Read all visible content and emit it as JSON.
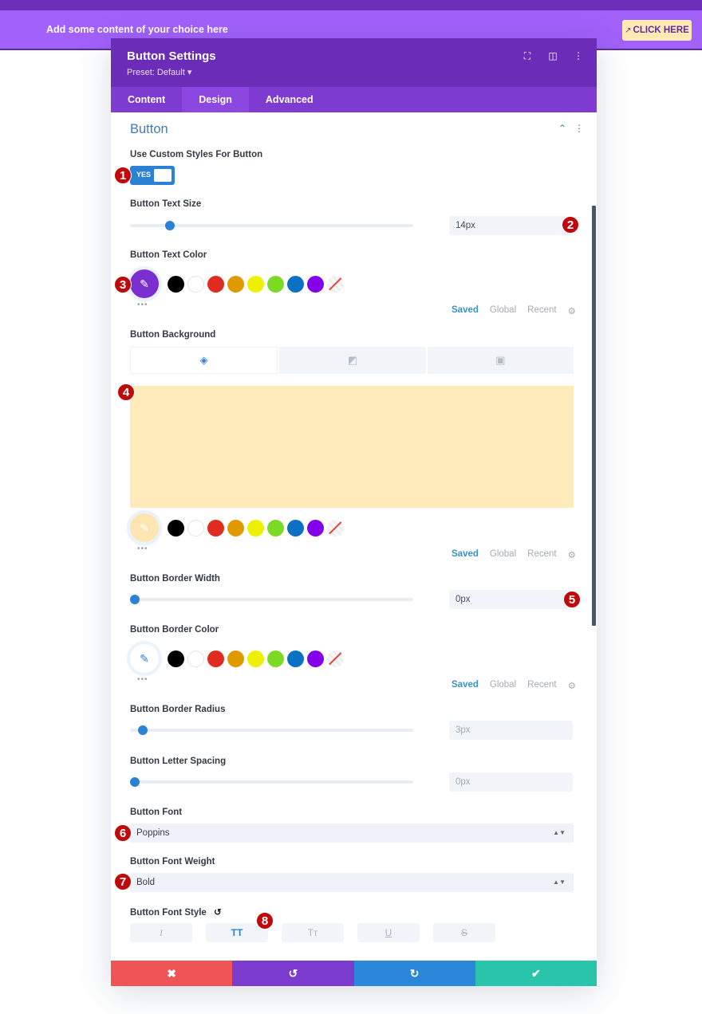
{
  "page": {
    "hero_text": "Add some content of your choice here",
    "hero_button": "CLICK HERE",
    "hero_button_icon": "arrow-up-right-icon"
  },
  "modal": {
    "title": "Button Settings",
    "preset": "Preset: Default ▾",
    "header_icons": [
      "focus-icon",
      "split-view-icon",
      "more-vertical-icon"
    ],
    "tabs": [
      {
        "label": "Content",
        "active": false
      },
      {
        "label": "Design",
        "active": true
      },
      {
        "label": "Advanced",
        "active": false
      }
    ],
    "section_title": "Button"
  },
  "fields": {
    "custom_styles": {
      "label": "Use Custom Styles For Button",
      "value": "YES"
    },
    "text_size": {
      "label": "Button Text Size",
      "value": "14px"
    },
    "text_color": {
      "label": "Button Text Color",
      "selected": "#7b2fd1"
    },
    "background": {
      "label": "Button Background",
      "value": "#ffebb9"
    },
    "border_width": {
      "label": "Button Border Width",
      "value": "0px"
    },
    "border_color": {
      "label": "Button Border Color"
    },
    "border_radius": {
      "label": "Button Border Radius",
      "value": "3px"
    },
    "letter_spacing": {
      "label": "Button Letter Spacing",
      "value": "0px"
    },
    "font": {
      "label": "Button Font",
      "value": "Poppins"
    },
    "font_weight": {
      "label": "Button Font Weight",
      "value": "Bold"
    },
    "font_style": {
      "label": "Button Font Style",
      "options": [
        "I",
        "TT",
        "Tт",
        "U",
        "S"
      ],
      "active": "TT"
    }
  },
  "palette": {
    "colors": [
      "#000000",
      "#ffffff",
      "#e02b20",
      "#e09900",
      "#edf000",
      "#7cda24",
      "#0c71c3",
      "#8300e9"
    ],
    "tabs": [
      "Saved",
      "Global",
      "Recent"
    ]
  },
  "footer": {
    "cancel_icon": "✖",
    "undo_icon": "↺",
    "redo_icon": "↻",
    "save_icon": "✔",
    "colors": {
      "cancel": "#ef5555",
      "undo": "#7c3bcf",
      "redo": "#2b87da",
      "save": "#29c4a9"
    }
  },
  "annotations": [
    "1",
    "2",
    "3",
    "4",
    "5",
    "6",
    "7",
    "8"
  ]
}
